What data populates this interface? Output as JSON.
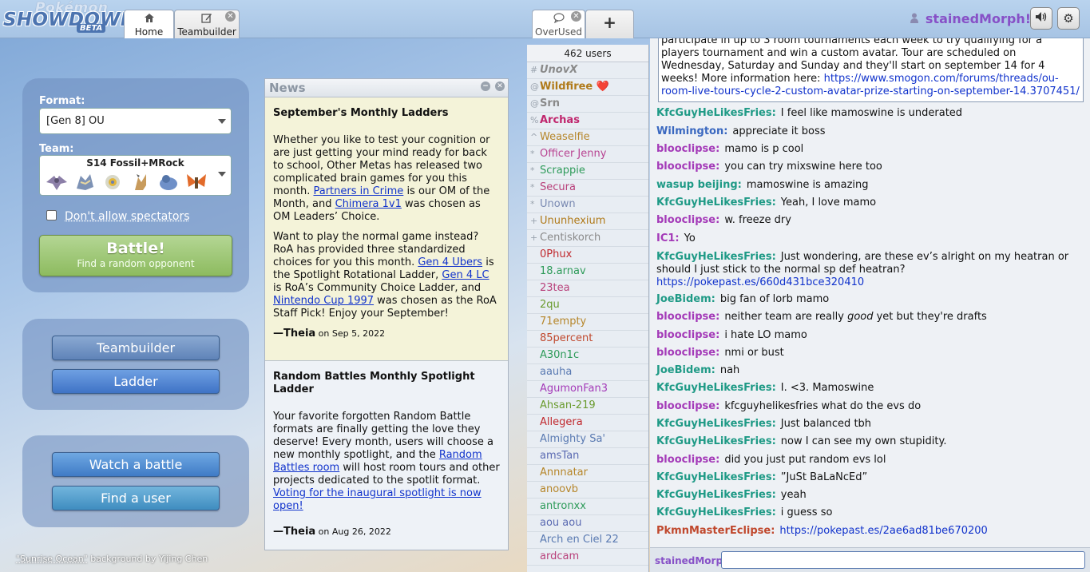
{
  "app": {
    "logo_top": "Pokémon",
    "logo_main": "SHOWDOWN",
    "logo_badge": "BETA"
  },
  "tabs": {
    "home": "Home",
    "teambuilder": "Teambuilder",
    "overused": "OverUsed",
    "add": "+"
  },
  "user": {
    "name": "stainedMorph!"
  },
  "home": {
    "format_label": "Format:",
    "format_value": "[Gen 8] OU",
    "team_label": "Team:",
    "team_name": "S14 Fossil+MRock",
    "spectators_label": "Don't allow spectators",
    "battle_title": "Battle!",
    "battle_sub": "Find a random opponent",
    "teambuilder_btn": "Teambuilder",
    "ladder_btn": "Ladder",
    "watch_btn": "Watch a battle",
    "finduser_btn": "Find a user",
    "credit_link": "\"Sunrise Ocean\"",
    "credit_rest": " background by Yijing Chen"
  },
  "news": {
    "title": "News",
    "item1": {
      "heading": "September's Monthly Ladders",
      "p1a": "Whether you like to test your cognition or are just getting your mind ready for back to school, Other Metas has released two complicated brain games for you this month. ",
      "p1_link1": "Partners in Crime",
      "p1b": " is our OM of the Month, and ",
      "p1_link2": "Chimera 1v1",
      "p1c": " was chosen as OM Leaders’ Choice.",
      "p2a": "Want to play the normal game instead? RoA has provided three standardized choices for you this month. ",
      "p2_link1": "Gen 4 Ubers",
      "p2b": " is the Spotlight Rotational Ladder, ",
      "p2_link2": "Gen 4 LC",
      "p2c": " is RoA’s Community Choice Ladder, and ",
      "p2_link3": "Nintendo Cup 1997",
      "p2d": " was chosen as the RoA Staff Pick! Enjoy your September!",
      "author": "—Theia",
      "date": " on Sep 5, 2022"
    },
    "item2": {
      "heading": "Random Battles Monthly Spotlight Ladder",
      "p1a": "Your favorite forgotten Random Battle formats are finally getting the love they deserve! Every month, users will choose a new monthly spotlight, and the ",
      "p1_link": "Random Battles room",
      "p1b": " will host room tours and other projects dedicated to the spotlit format. ",
      "p1_link2": "Voting for the inaugural spotlight is now open!",
      "author": "—Theia",
      "date": " on Aug 26, 2022"
    }
  },
  "userlist": {
    "count": "462 users",
    "users": [
      {
        "g": "#",
        "name": "UnovX",
        "color": "#8a8a8a",
        "style": "italic bold"
      },
      {
        "g": "@",
        "name": "Wildfiree ❤️",
        "color": "#b07a1a",
        "style": "bold"
      },
      {
        "g": "@",
        "name": "Srn",
        "color": "#8a8a8a",
        "style": "bold"
      },
      {
        "g": "%",
        "name": "Archas",
        "color": "#c0266d",
        "style": "bold"
      },
      {
        "g": "^",
        "name": "Weaselfie",
        "color": "#b6862a",
        "style": ""
      },
      {
        "g": "*",
        "name": "Officer Jenny",
        "color": "#b84492",
        "style": ""
      },
      {
        "g": "*",
        "name": "Scrappie",
        "color": "#2e9b5a",
        "style": ""
      },
      {
        "g": "*",
        "name": "Secura",
        "color": "#b8407a",
        "style": ""
      },
      {
        "g": "*",
        "name": "Unown",
        "color": "#7a8ab2",
        "style": ""
      },
      {
        "g": "+",
        "name": "Ununhexium",
        "color": "#b07a1a",
        "style": ""
      },
      {
        "g": "+",
        "name": "Centiskorch",
        "color": "#8a8a8a",
        "style": ""
      },
      {
        "g": "",
        "name": "0Phux",
        "color": "#c0282d",
        "style": ""
      },
      {
        "g": "",
        "name": "18.arnav",
        "color": "#2e9b5a",
        "style": ""
      },
      {
        "g": "",
        "name": "23tea",
        "color": "#b8407a",
        "style": ""
      },
      {
        "g": "",
        "name": "2qu",
        "color": "#6a9b2e",
        "style": ""
      },
      {
        "g": "",
        "name": "71empty",
        "color": "#b6862a",
        "style": ""
      },
      {
        "g": "",
        "name": "85percent",
        "color": "#c0482d",
        "style": ""
      },
      {
        "g": "",
        "name": "A30n1c",
        "color": "#2e9b5a",
        "style": ""
      },
      {
        "g": "",
        "name": "aauha",
        "color": "#5a7ab2",
        "style": ""
      },
      {
        "g": "",
        "name": "AgumonFan3",
        "color": "#a43ab8",
        "style": ""
      },
      {
        "g": "",
        "name": "Ahsan-219",
        "color": "#6a9b2e",
        "style": ""
      },
      {
        "g": "",
        "name": "Allegera",
        "color": "#c0282d",
        "style": ""
      },
      {
        "g": "",
        "name": "Almighty Sa'",
        "color": "#5a7ab2",
        "style": ""
      },
      {
        "g": "",
        "name": "amsTan",
        "color": "#5a6ab2",
        "style": ""
      },
      {
        "g": "",
        "name": "Annnatar",
        "color": "#b6862a",
        "style": ""
      },
      {
        "g": "",
        "name": "anoovb",
        "color": "#b6862a",
        "style": ""
      },
      {
        "g": "",
        "name": "antronxx",
        "color": "#2e9b5a",
        "style": ""
      },
      {
        "g": "",
        "name": "aou aou",
        "color": "#5a6ab2",
        "style": ""
      },
      {
        "g": "",
        "name": "Arch en Ciel 22",
        "color": "#5a7ab2",
        "style": ""
      },
      {
        "g": "",
        "name": "ardcam",
        "color": "#b8407a",
        "style": ""
      }
    ]
  },
  "chat": {
    "announce": {
      "top_text": "participate in up to 3 room tournaments each week to try qualifying for a players tournament and win a custom avatar. Tour are scheduled on Wednesday, Saturday and Sunday and they'll start on september 14 for 4 weeks! More information here: ",
      "link": "https://www.smogon.com/forums/threads/ou-room-live-tours-cycle-2-custom-avatar-prize-starting-on-september-14.3707451/"
    },
    "messages": [
      {
        "name": "KfcGuyHeLikesFries:",
        "color": "#1f9a86",
        "text": "I feel like mamoswine is underated",
        "link": ""
      },
      {
        "name": "Wilmington:",
        "color": "#3a68c0",
        "text": "appreciate it boss",
        "link": ""
      },
      {
        "name": "blooclipse:",
        "color": "#a43ab8",
        "text": "mamo is p cool",
        "link": ""
      },
      {
        "name": "blooclipse:",
        "color": "#a43ab8",
        "text": "you can try mixswine here too",
        "link": ""
      },
      {
        "name": "wasup beijing:",
        "color": "#1f9a86",
        "text": "mamoswine is amazing",
        "link": ""
      },
      {
        "name": "KfcGuyHeLikesFries:",
        "color": "#1f9a86",
        "text": "Yeah, I love mamo",
        "link": ""
      },
      {
        "name": "blooclipse:",
        "color": "#a43ab8",
        "text": "w. freeze dry",
        "link": ""
      },
      {
        "name": "IC1:",
        "color": "#a43ab8",
        "text": "Yo",
        "link": ""
      },
      {
        "name": "KfcGuyHeLikesFries:",
        "color": "#1f9a86",
        "text": "Just wondering, are these ev’s alright on my heatran or should I just stick to the normal sp def heatran?",
        "link": "https://pokepast.es/660d431bce320410"
      },
      {
        "name": "JoeBidem:",
        "color": "#1f9a86",
        "text": "big fan of lorb mamo",
        "link": ""
      },
      {
        "name": "blooclipse:",
        "color": "#a43ab8",
        "text": "neither team are really <i>good</i> yet but they're drafts",
        "link": ""
      },
      {
        "name": "blooclipse:",
        "color": "#a43ab8",
        "text": "i hate LO mamo",
        "link": ""
      },
      {
        "name": "blooclipse:",
        "color": "#a43ab8",
        "text": "nmi or bust",
        "link": ""
      },
      {
        "name": "JoeBidem:",
        "color": "#1f9a86",
        "text": "nah",
        "link": ""
      },
      {
        "name": "KfcGuyHeLikesFries:",
        "color": "#1f9a86",
        "text": "I. <3. Mamoswine",
        "link": ""
      },
      {
        "name": "blooclipse:",
        "color": "#a43ab8",
        "text": "kfcguyhelikesfries what do the evs do",
        "link": ""
      },
      {
        "name": "KfcGuyHeLikesFries:",
        "color": "#1f9a86",
        "text": "Just balanced tbh",
        "link": ""
      },
      {
        "name": "KfcGuyHeLikesFries:",
        "color": "#1f9a86",
        "text": "now I can see my own stupidity.",
        "link": ""
      },
      {
        "name": "blooclipse:",
        "color": "#a43ab8",
        "text": "did you just put random evs lol",
        "link": ""
      },
      {
        "name": "KfcGuyHeLikesFries:",
        "color": "#1f9a86",
        "text": "”JuSt BaLaNcEd”",
        "link": ""
      },
      {
        "name": "KfcGuyHeLikesFries:",
        "color": "#1f9a86",
        "text": "yeah",
        "link": ""
      },
      {
        "name": "KfcGuyHeLikesFries:",
        "color": "#1f9a86",
        "text": "i guess so",
        "link": ""
      },
      {
        "name": "PkmnMasterEclipse:",
        "color": "#c0482d",
        "text": "",
        "link": "https://pokepast.es/2ae6ad81be670200"
      }
    ],
    "input_name": "stainedMorp"
  }
}
